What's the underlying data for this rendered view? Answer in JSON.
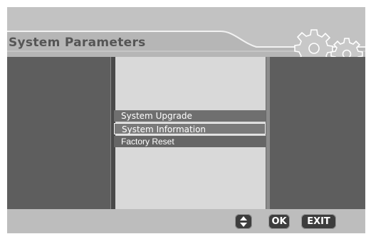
{
  "header": {
    "title": "System Parameters",
    "decoration_icon": "gears-icon"
  },
  "menu": {
    "items": [
      {
        "label": "System  Upgrade"
      },
      {
        "label": "System  Information"
      },
      {
        "label": "Factory Reset"
      }
    ]
  },
  "footer": {
    "navigate_icon": "up-down-arrows-icon",
    "ok_label": "OK",
    "exit_label": "EXIT"
  },
  "colors": {
    "background": "#c2c2c2",
    "dark_panel": "#5e5e5e",
    "center_panel": "#d9d9d9",
    "button": "#3d3d3d"
  }
}
